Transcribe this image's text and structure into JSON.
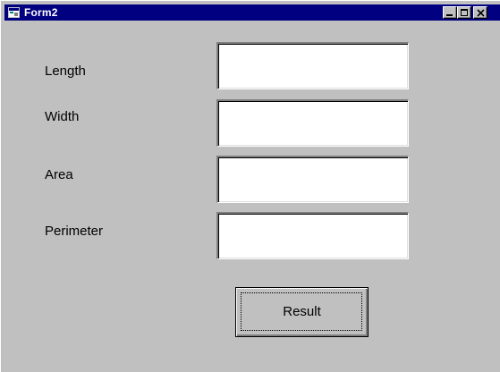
{
  "window": {
    "title": "Form2",
    "icon": "form-app-icon",
    "controls": {
      "minimize": "minimize-icon",
      "maximize": "maximize-icon",
      "close": "close-icon"
    },
    "title_bar_color": "#000080",
    "background_color": "#c0c0c0"
  },
  "form": {
    "fields": [
      {
        "label": "Length",
        "value": "",
        "placeholder": ""
      },
      {
        "label": "Width",
        "value": "",
        "placeholder": ""
      },
      {
        "label": "Area",
        "value": "",
        "placeholder": ""
      },
      {
        "label": "Perimeter",
        "value": "",
        "placeholder": ""
      }
    ],
    "result_button_label": "Result"
  }
}
